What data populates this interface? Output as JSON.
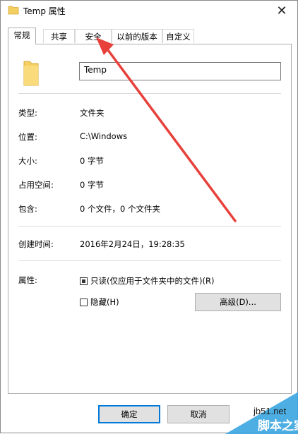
{
  "window": {
    "title": "Temp 属性",
    "close_glyph": "✕"
  },
  "tabs": [
    {
      "label": "常规",
      "active": true
    },
    {
      "label": "共享",
      "active": false
    },
    {
      "label": "安全",
      "active": false
    },
    {
      "label": "以前的版本",
      "active": false
    },
    {
      "label": "自定义",
      "active": false
    }
  ],
  "general": {
    "folder_name": "Temp",
    "rows": [
      {
        "label": "类型:",
        "value": "文件夹"
      },
      {
        "label": "位置:",
        "value": "C:\\Windows"
      },
      {
        "label": "大小:",
        "value": "0 字节"
      },
      {
        "label": "占用空间:",
        "value": "0 字节"
      },
      {
        "label": "包含:",
        "value": "0 个文件，0 个文件夹"
      }
    ],
    "created_label": "创建时间:",
    "created_value": "2016年2月24日，19:28:35",
    "attributes_label": "属性:",
    "readonly_label": "只读(仅应用于文件夹中的文件)(R)",
    "readonly_state": "indeterminate",
    "hidden_label": "隐藏(H)",
    "hidden_checked": false,
    "advanced_label": "高级(D)..."
  },
  "footer": {
    "ok_label": "确定",
    "cancel_label": "取消"
  },
  "watermark": {
    "site": "jb51.net",
    "brand": "脚本之家"
  },
  "annotation": {
    "arrow_color": "#e8403a"
  }
}
